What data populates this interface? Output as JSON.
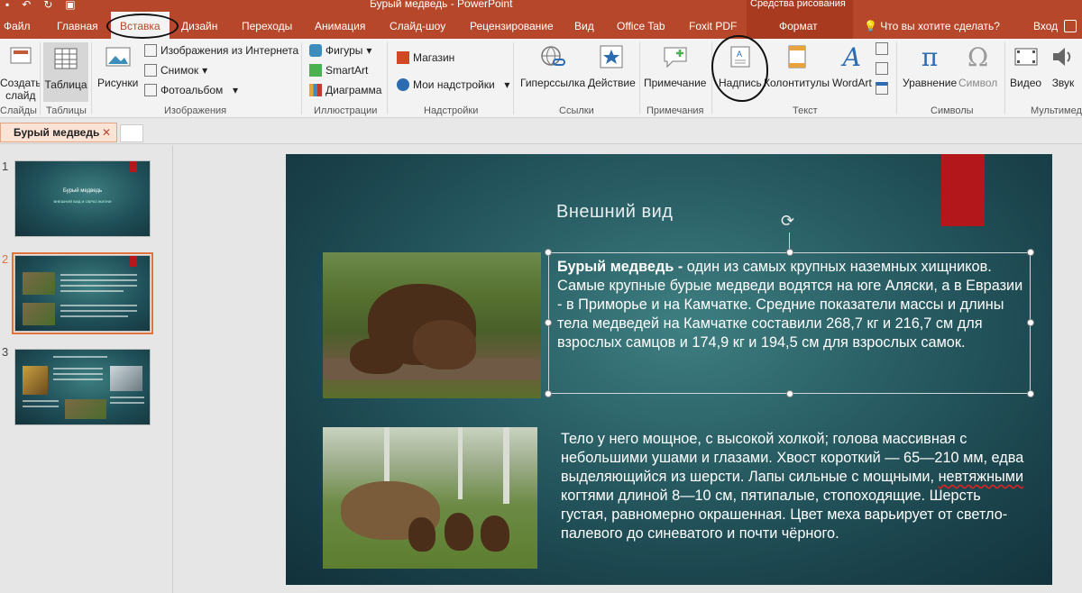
{
  "app": {
    "window_title": "Бурый медведь - PowerPoint",
    "context_tools": "Средства рисования"
  },
  "tabs": {
    "file": "Файл",
    "home": "Главная",
    "insert": "Вставка",
    "design": "Дизайн",
    "transitions": "Переходы",
    "animation": "Анимация",
    "slideshow": "Слайд-шоу",
    "review": "Рецензирование",
    "view": "Вид",
    "officetab": "Office Tab",
    "foxit": "Foxit PDF",
    "format": "Формат",
    "tell_me": "Что вы хотите сделать?",
    "sign_in": "Вход"
  },
  "ribbon": {
    "slides": {
      "new_slide": "Создать",
      "new_slide2": "слайд",
      "group": "Слайды"
    },
    "tables": {
      "table": "Таблица",
      "group": "Таблицы"
    },
    "images": {
      "pictures": "Рисунки",
      "online": "Изображения из Интернета",
      "snapshot": "Снимок",
      "album": "Фотоальбом",
      "group": "Изображения"
    },
    "illustrations": {
      "shapes": "Фигуры",
      "smartart": "SmartArt",
      "chart": "Диаграмма",
      "group": "Иллюстрации"
    },
    "addins": {
      "store": "Магазин",
      "my_addins": "Мои надстройки",
      "group": "Надстройки"
    },
    "links": {
      "hyperlink": "Гиперссылка",
      "action": "Действие",
      "group": "Ссылки"
    },
    "comments": {
      "comment": "Примечание",
      "group": "Примечания"
    },
    "text": {
      "textbox": "Надпись",
      "header_footer": "Колонтитулы",
      "wordart": "WordArt",
      "group": "Текст"
    },
    "symbols": {
      "equation": "Уравнение",
      "symbol": "Символ",
      "group": "Символы"
    },
    "media": {
      "video": "Видео",
      "audio": "Звук",
      "group": "Мультимед"
    }
  },
  "doc_tab": {
    "name": "Бурый медведь",
    "close": "✕"
  },
  "thumbnails": [
    {
      "num": "1",
      "title": "Бурый медведь",
      "subtitle": "ВНЕШНИЙ ВИД И ОБРАЗ ЖИЗНИ"
    },
    {
      "num": "2"
    },
    {
      "num": "3"
    }
  ],
  "slide": {
    "title": "Внешний вид",
    "para1_bold": "Бурый медведь -",
    "para1_rest": " один из самых крупных наземных хищников.",
    "para1_2": "Самые крупные бурые медведи водятся на юге Аляски, а в Евразии - в Приморье и на Камчатке. Средние показатели массы и длины тела медведей на Камчатке составили 268,7 кг и 216,7 см для взрослых самцов и 174,9 кг и 194,5 см для взрослых самок.",
    "para2_a": "Тело у него мощное, с высокой холкой; голова массивная с небольшими ушами и глазами. Хвост короткий — 65—210 мм, едва выделяющийся из шерсти. Лапы сильные с мощными, ",
    "para2_squig": "невтяжными",
    "para2_b": " когтями длиной 8—10 см, пятипалые, стопоходящие. Шерсть густая, равномерно окрашенная. Цвет меха варьирует от светло-палевого до синеватого и почти чёрного."
  }
}
